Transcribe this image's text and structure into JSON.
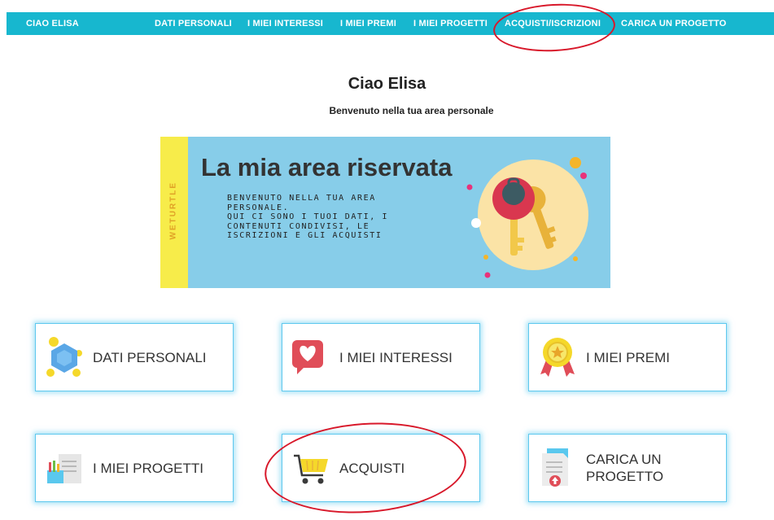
{
  "nav": {
    "greeting": "CIAO ELISA",
    "items": [
      "DATI PERSONALI",
      "I MIEI INTERESSI",
      "I MIEI PREMI",
      "I MIEI PROGETTI",
      "ACQUISTI/ISCRIZIONI",
      "CARICA UN PROGETTO"
    ]
  },
  "welcome": {
    "title": "Ciao Elisa",
    "subtitle": "Benvenuto nella tua area personale"
  },
  "banner": {
    "side_label": "WETURTLE",
    "headline": "La mia area riservata",
    "body_lines": [
      "BENVENUTO NELLA TUA AREA",
      "PERSONALE.",
      "QUI CI SONO I TUOI DATI, I",
      "CONTENUTI CONDIVISI, LE",
      "ISCRIZIONI E GLI ACQUISTI"
    ]
  },
  "cards": [
    {
      "label": "DATI PERSONALI",
      "icon": "turtle-icon"
    },
    {
      "label": "I MIEI INTERESSI",
      "icon": "heart-chat-icon"
    },
    {
      "label": "I MIEI PREMI",
      "icon": "award-ribbon-icon"
    },
    {
      "label": "I MIEI PROGETTI",
      "icon": "project-document-icon"
    },
    {
      "label": "ACQUISTI",
      "icon": "shopping-cart-icon"
    },
    {
      "label": "CARICA UN PROGETTO",
      "icon": "upload-document-icon"
    }
  ],
  "colors": {
    "nav_bg": "#17b7cf",
    "card_border": "#5ec8ee",
    "banner_bg": "#87cde9",
    "banner_stripe": "#f7ec4a",
    "annotation": "#d8182a"
  }
}
